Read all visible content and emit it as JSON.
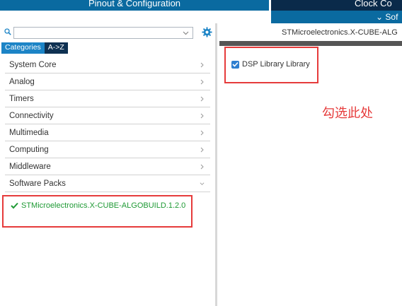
{
  "header": {
    "tab_pinout": "Pinout & Configuration",
    "tab_clock": "Clock Co",
    "subbar_label": "⌄ Sof"
  },
  "left_panel": {
    "search": {
      "value": "",
      "placeholder": ""
    },
    "category_tabs": [
      {
        "label": "Categories",
        "active": true
      },
      {
        "label": "A->Z",
        "active": false
      }
    ],
    "tree_items": [
      {
        "label": "System Core",
        "chevron": "chevron-right-icon"
      },
      {
        "label": "Analog",
        "chevron": "chevron-right-icon"
      },
      {
        "label": "Timers",
        "chevron": "chevron-right-icon"
      },
      {
        "label": "Connectivity",
        "chevron": "chevron-right-icon"
      },
      {
        "label": "Multimedia",
        "chevron": "chevron-right-icon"
      },
      {
        "label": "Computing",
        "chevron": "chevron-right-icon"
      },
      {
        "label": "Middleware",
        "chevron": "chevron-right-icon"
      },
      {
        "label": "Software Packs",
        "chevron": "chevron-down-icon"
      }
    ],
    "selected_pack": "STMicroelectronics.X-CUBE-ALGOBUILD.1.2.0"
  },
  "right_panel": {
    "title": "STMicroelectronics.X-CUBE-ALG",
    "dsp_checkbox": {
      "label": "DSP Library Library",
      "checked": true
    }
  },
  "annotation": {
    "text": "勾选此处"
  },
  "colors": {
    "accent_blue": "#0a6aa0",
    "dark_navy": "#0a2a4a",
    "highlight_red": "#e63b3b",
    "pack_green": "#1f9a35"
  }
}
